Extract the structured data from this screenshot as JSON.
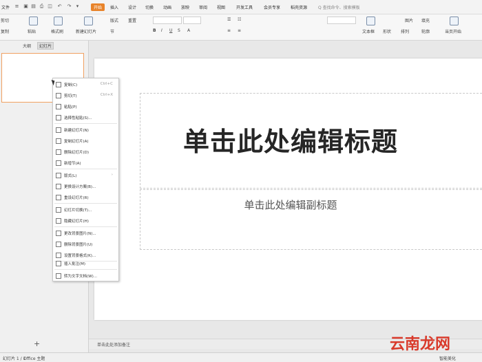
{
  "menubar": {
    "file_label": "文件",
    "tabs": [
      {
        "label": "开始",
        "active": true
      },
      {
        "label": "插入"
      },
      {
        "label": "设计"
      },
      {
        "label": "切换"
      },
      {
        "label": "动画"
      },
      {
        "label": "放映"
      },
      {
        "label": "审阅"
      },
      {
        "label": "视图"
      },
      {
        "label": "开发工具"
      },
      {
        "label": "会员专享"
      },
      {
        "label": "稻壳资源"
      }
    ],
    "search_placeholder": "Q 查找命令、搜索模板",
    "accent": "#e8832a"
  },
  "ribbon": {
    "cut": "剪切",
    "copy": "复制",
    "paste": "粘贴",
    "format_painter": "格式刷",
    "new_slide": "新建幻灯片",
    "layout": "版式",
    "section": "节",
    "reset": "重置",
    "text_box": "文本框",
    "shape": "形状",
    "arrange": "排列",
    "outline": "轮廓",
    "picture": "图片",
    "fill": "填充",
    "play": "当页开始"
  },
  "sidebar": {
    "tabs": [
      {
        "label": "大纲"
      },
      {
        "label": "幻灯片",
        "active": true
      }
    ],
    "add_label": "+"
  },
  "slide": {
    "title": "单击此处编辑标题",
    "subtitle": "单击此处编辑副标题"
  },
  "context_menu": {
    "groups": [
      [
        {
          "label": "复制(C)",
          "shortcut": "Ctrl+C"
        },
        {
          "label": "剪切(T)",
          "shortcut": "Ctrl+X"
        },
        {
          "label": "粘贴(P)"
        },
        {
          "label": "选择性粘贴(S)..."
        }
      ],
      [
        {
          "label": "新建幻灯片(N)"
        },
        {
          "label": "复制幻灯片(A)"
        },
        {
          "label": "删除幻灯片(D)"
        },
        {
          "label": "新增节(A)"
        }
      ],
      [
        {
          "label": "版式(L)"
        },
        {
          "label": "更换设计方案(B)..."
        },
        {
          "label": "重设幻灯片(R)"
        }
      ],
      [
        {
          "label": "幻灯片切换(T)..."
        },
        {
          "label": "隐藏幻灯片(H)"
        }
      ],
      [
        {
          "label": "更改背景图片(N)..."
        },
        {
          "label": "删除背景图片(U)"
        },
        {
          "label": "设置背景格式(K)..."
        }
      ],
      [
        {
          "label": "插入批注(M)"
        }
      ],
      [
        {
          "label": "转为文字文档(W)..."
        }
      ]
    ]
  },
  "notes": {
    "placeholder": "单击此处添加备注"
  },
  "status": {
    "slide_count": "幻灯片 1 / 1",
    "theme": "Office 主题",
    "smart_beautify": "智能美化"
  },
  "watermark": "云南龙网"
}
